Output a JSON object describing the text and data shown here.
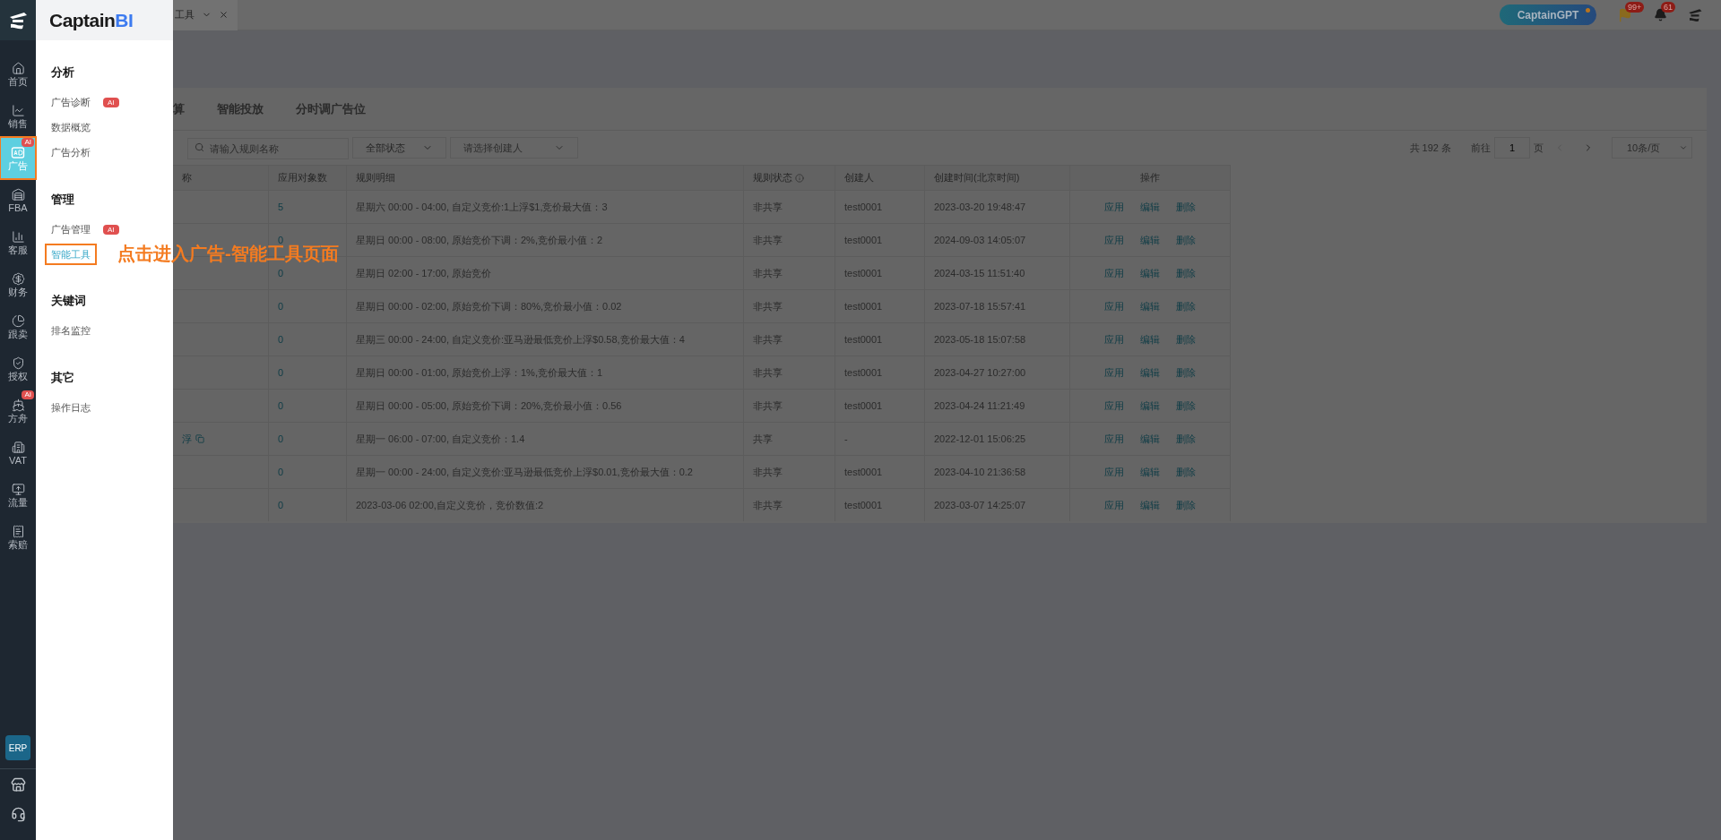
{
  "sidebar": {
    "items": [
      {
        "label": "首页",
        "selected": false,
        "highlighted": false
      },
      {
        "label": "销售",
        "selected": false,
        "highlighted": false
      },
      {
        "label": "广告",
        "selected": true,
        "highlighted": true,
        "badge": "AI"
      },
      {
        "label": "FBA",
        "selected": false,
        "highlighted": false
      },
      {
        "label": "客服",
        "selected": false,
        "highlighted": false
      },
      {
        "label": "财务",
        "selected": false,
        "highlighted": false
      },
      {
        "label": "跟卖",
        "selected": false,
        "highlighted": false
      },
      {
        "label": "授权",
        "selected": false,
        "highlighted": false
      },
      {
        "label": "方舟",
        "selected": false,
        "highlighted": false,
        "badge": "AI"
      },
      {
        "label": "VAT",
        "selected": false,
        "highlighted": false
      },
      {
        "label": "流量",
        "selected": false,
        "highlighted": false
      },
      {
        "label": "索赔",
        "selected": false,
        "highlighted": false
      }
    ],
    "erp": "ERP"
  },
  "flyout": {
    "brand": "Captain",
    "brand_accent": "BI",
    "sections": [
      {
        "title": "分析",
        "items": [
          {
            "label": "广告诊断",
            "badge": "AI",
            "selected": false,
            "highlighted": false
          },
          {
            "label": "数据概览",
            "selected": false,
            "highlighted": false
          },
          {
            "label": "广告分析",
            "selected": false,
            "highlighted": false
          }
        ]
      },
      {
        "title": "管理",
        "items": [
          {
            "label": "广告管理",
            "badge": "AI",
            "selected": false,
            "highlighted": false
          },
          {
            "label": "智能工具",
            "selected": true,
            "highlighted": true
          }
        ]
      },
      {
        "title": "关键词",
        "items": [
          {
            "label": "排名监控",
            "selected": false,
            "highlighted": false
          }
        ]
      },
      {
        "title": "其它",
        "items": [
          {
            "label": "操作日志",
            "selected": false,
            "highlighted": false
          }
        ]
      }
    ]
  },
  "annotation": {
    "text": "点击进入广告-智能工具页面"
  },
  "tab_strip": {
    "tabs": [
      {
        "label": "工具",
        "selected": true
      }
    ]
  },
  "top_bar": {
    "gpt_button": "CaptainGPT",
    "flag_badge": "99+",
    "bell_badge": "61"
  },
  "sub_tabs": [
    {
      "label": "算",
      "selected": false
    },
    {
      "label": "智能投放",
      "selected": false
    },
    {
      "label": "分时调广告位",
      "selected": false
    }
  ],
  "filters": {
    "search": {
      "placeholder": "请输入规则名称"
    },
    "status": {
      "value": "全部状态"
    },
    "creator": {
      "placeholder": "请选择创建人"
    }
  },
  "pagination": {
    "total": "共 192 条",
    "goto_label": "前往",
    "page": "1",
    "page_suffix": "页",
    "page_size": "10条/页"
  },
  "table": {
    "columns": [
      "称",
      "应用对象数",
      "规则明细",
      "规则状态",
      "创建人",
      "创建时间(北京时间)",
      "操作"
    ],
    "rows": [
      {
        "name": "",
        "count": "5",
        "detail": "星期六 00:00 - 04:00, 自定义竞价:1上浮$1,竞价最大值：3",
        "status": "非共享",
        "creator": "test0001",
        "created": "2023-03-20 19:48:47",
        "actions": [
          "应用",
          "编辑",
          "删除"
        ]
      },
      {
        "name": "",
        "count": "0",
        "detail": "星期日 00:00 - 08:00, 原始竞价下调：2%,竞价最小值：2",
        "status": "非共享",
        "creator": "test0001",
        "created": "2024-09-03 14:05:07",
        "actions": [
          "应用",
          "编辑",
          "删除"
        ]
      },
      {
        "name": "",
        "count": "0",
        "detail": "星期日 02:00 - 17:00, 原始竞价",
        "status": "非共享",
        "creator": "test0001",
        "created": "2024-03-15 11:51:40",
        "actions": [
          "应用",
          "编辑",
          "删除"
        ]
      },
      {
        "name": "",
        "count": "0",
        "detail": "星期日 00:00 - 02:00, 原始竞价下调：80%,竞价最小值：0.02",
        "status": "非共享",
        "creator": "test0001",
        "created": "2023-07-18 15:57:41",
        "actions": [
          "应用",
          "编辑",
          "删除"
        ]
      },
      {
        "name": "",
        "count": "0",
        "detail": "星期三 00:00 - 24:00, 自定义竞价:亚马逊最低竞价上浮$0.58,竞价最大值：4",
        "status": "非共享",
        "creator": "test0001",
        "created": "2023-05-18 15:07:58",
        "actions": [
          "应用",
          "编辑",
          "删除"
        ]
      },
      {
        "name": "",
        "count": "0",
        "detail": "星期日 00:00 - 01:00, 原始竞价上浮：1%,竞价最大值：1",
        "status": "非共享",
        "creator": "test0001",
        "created": "2023-04-27 10:27:00",
        "actions": [
          "应用",
          "编辑",
          "删除"
        ]
      },
      {
        "name": "",
        "count": "0",
        "detail": "星期日 00:00 - 05:00, 原始竞价下调：20%,竞价最小值：0.56",
        "status": "非共享",
        "creator": "test0001",
        "created": "2023-04-24 11:21:49",
        "actions": [
          "应用",
          "编辑",
          "删除"
        ]
      },
      {
        "name": "浮",
        "copyable": true,
        "count": "0",
        "detail": "星期一 06:00 - 07:00, 自定义竞价：1.4",
        "status": "共享",
        "creator": "-",
        "created": "2022-12-01 15:06:25",
        "actions": [
          "应用",
          "编辑",
          "删除"
        ]
      },
      {
        "name": "",
        "count": "0",
        "detail": "星期一 00:00 - 24:00, 自定义竞价:亚马逊最低竞价上浮$0.01,竞价最大值：0.2",
        "status": "非共享",
        "creator": "test0001",
        "created": "2023-04-10 21:36:58",
        "actions": [
          "应用",
          "编辑",
          "删除"
        ]
      },
      {
        "name": "",
        "count": "0",
        "detail": "2023-03-06 02:00,自定义竞价，竞价数值:2",
        "status": "非共享",
        "creator": "test0001",
        "created": "2023-03-07 14:25:07",
        "actions": [
          "应用",
          "编辑",
          "删除"
        ]
      }
    ]
  }
}
